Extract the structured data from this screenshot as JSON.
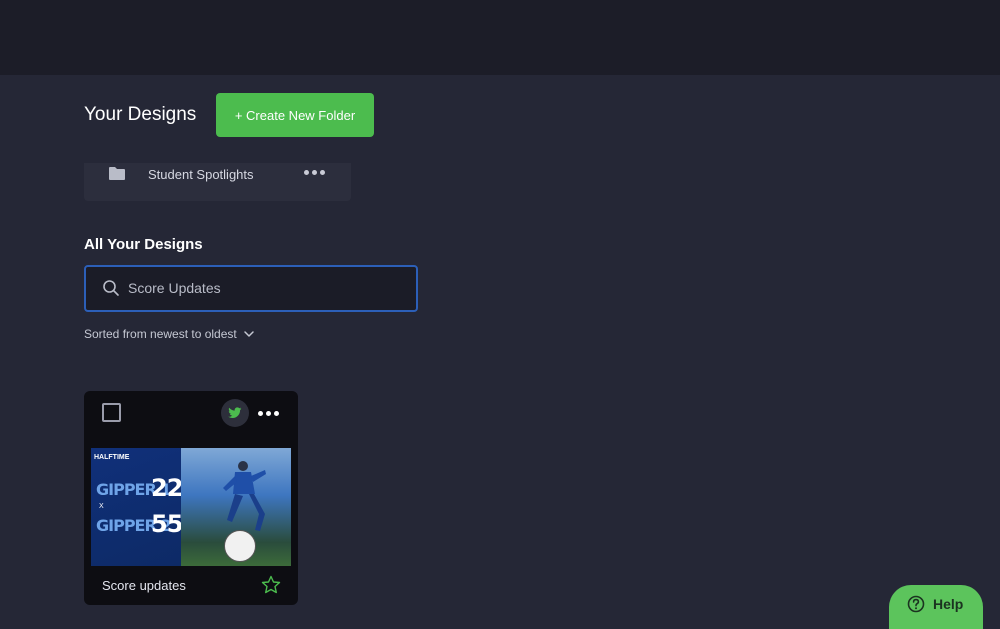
{
  "header": {
    "title": "Your Designs",
    "create_folder_label": "+ Create New Folder"
  },
  "folders": [
    {
      "name": "Student Spotlights"
    }
  ],
  "all_designs": {
    "title": "All Your Designs",
    "search_value": "Score Updates",
    "search_placeholder": "Search",
    "sort_label": "Sorted from newest to oldest"
  },
  "designs": [
    {
      "name": "Score updates",
      "platform_icon": "twitter-icon",
      "thumbnail": {
        "badge": "HALFTIME",
        "team1": "GIPPER 1",
        "score1": "22",
        "vs": "X",
        "team2": "GIPPER 2",
        "score2": "55"
      }
    }
  ],
  "help": {
    "label": "Help"
  },
  "colors": {
    "accent_green": "#4cbc4e",
    "search_border": "#2c5fb8",
    "background": "#252736"
  }
}
